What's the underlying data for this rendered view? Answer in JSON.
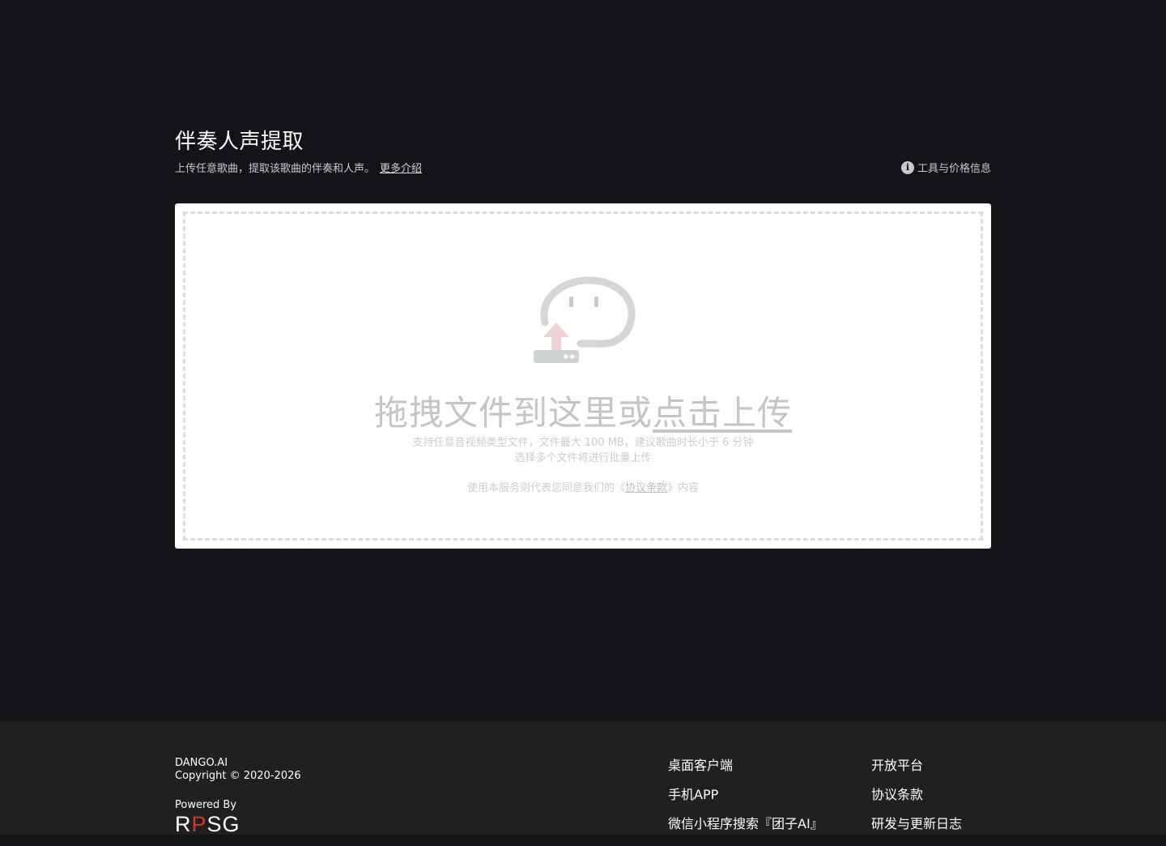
{
  "header": {
    "title": "伴奏人声提取",
    "subtitle": "上传任意歌曲，提取该歌曲的伴奏和人声。",
    "more_link": "更多介绍",
    "tool_info": "工具与价格信息"
  },
  "upload": {
    "heading_prefix": "拖拽文件到这里或",
    "heading_link": "点击上传",
    "desc_line1": "支持任意音视频类型文件，文件最大 100 MB，建议歌曲时长小于 6 分钟",
    "desc_line2": "选择多个文件将进行批量上传",
    "terms_prefix": "使用本服务则代表您同意我们的《",
    "terms_link": "协议条款",
    "terms_suffix": "》内容"
  },
  "footer": {
    "brand": "DANGO.AI",
    "copyright": "Copyright © 2020-2026",
    "powered_by": "Powered By",
    "logo_r": "R",
    "logo_p": "P",
    "logo_sg": "SG",
    "col1": [
      "桌面客户端",
      "手机APP",
      "微信小程序搜索『团子AI』"
    ],
    "col2": [
      "开放平台",
      "协议条款",
      "研发与更新日志"
    ]
  }
}
